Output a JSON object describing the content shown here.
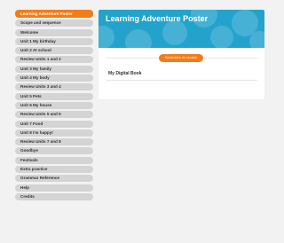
{
  "sidebar": {
    "items": [
      {
        "label": "Learning Adventure Poster"
      },
      {
        "label": "Scope and sequence"
      },
      {
        "label": "Welcome"
      },
      {
        "label": "Unit 1 My birthday"
      },
      {
        "label": "Unit 2 At school"
      },
      {
        "label": "Review Units 1 and 2"
      },
      {
        "label": "Unit 3 My family"
      },
      {
        "label": "Unit 4 My body"
      },
      {
        "label": "Review Units 3 and 4"
      },
      {
        "label": "Unit 5 Pets"
      },
      {
        "label": "Unit 6 My house"
      },
      {
        "label": "Review Units 5 and 6"
      },
      {
        "label": "Unit 7 Food"
      },
      {
        "label": "Unit 8 I'm happy!"
      },
      {
        "label": "Review Units 7 and 8"
      },
      {
        "label": "Goodbye"
      },
      {
        "label": "Festivals"
      },
      {
        "label": "Extra practice"
      },
      {
        "label": "Grammar Reference"
      },
      {
        "label": "Help"
      },
      {
        "label": "Credits"
      }
    ]
  },
  "main": {
    "title": "Learning Adventure Poster",
    "action_label": "Contenidos de sección",
    "section_label": "My Digital Book"
  },
  "colors": {
    "accent": "#f07d1a",
    "banner": "#23a3cc",
    "nav_item": "#d4d4d4",
    "background": "#f2f2f2"
  }
}
